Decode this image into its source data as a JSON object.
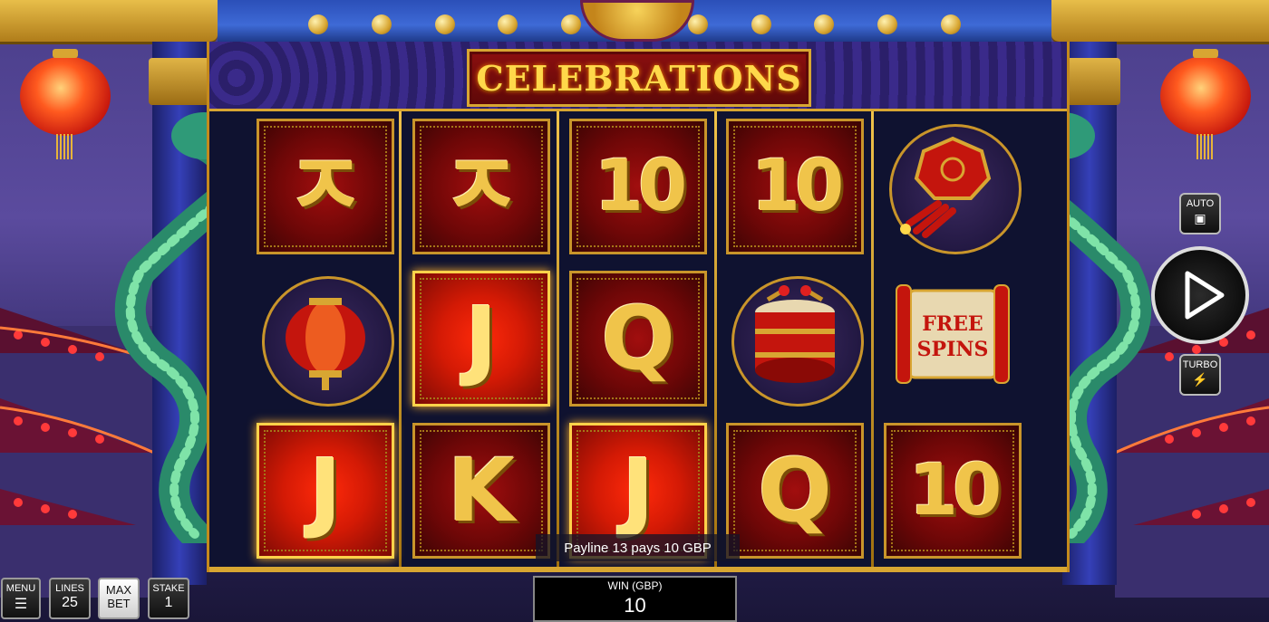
{
  "game": {
    "title": "CELEBRATIONS",
    "payline_message": "Payline 13 pays 10 GBP"
  },
  "reels": [
    [
      "A",
      "lantern",
      "J"
    ],
    [
      "A",
      "J",
      "K"
    ],
    [
      "10",
      "Q",
      "J"
    ],
    [
      "10",
      "drum",
      "Q"
    ],
    [
      "firecracker",
      "free-spins",
      "10"
    ]
  ],
  "highlighted_symbols": [
    {
      "reel": 1,
      "row": 2
    },
    {
      "reel": 0,
      "row": 3
    },
    {
      "reel": 2,
      "row": 3
    }
  ],
  "symbol_labels": {
    "A": "ㅈ",
    "free_spins_line1": "FREE",
    "free_spins_line2": "SPINS"
  },
  "side_controls": {
    "auto_label": "AUTO",
    "turbo_label": "TURBO"
  },
  "bottom_controls": {
    "menu_label": "MENU",
    "lines_label": "LINES",
    "lines_value": "25",
    "maxbet_line1": "MAX",
    "maxbet_line2": "BET",
    "stake_label": "STAKE",
    "stake_value": "1",
    "win_label": "WIN (GBP)",
    "win_value": "10"
  },
  "colors": {
    "gold": "#d8a632",
    "tile_red": "#6e0707",
    "highlight_red": "#d41a05",
    "pillar_blue": "#3540b8"
  }
}
